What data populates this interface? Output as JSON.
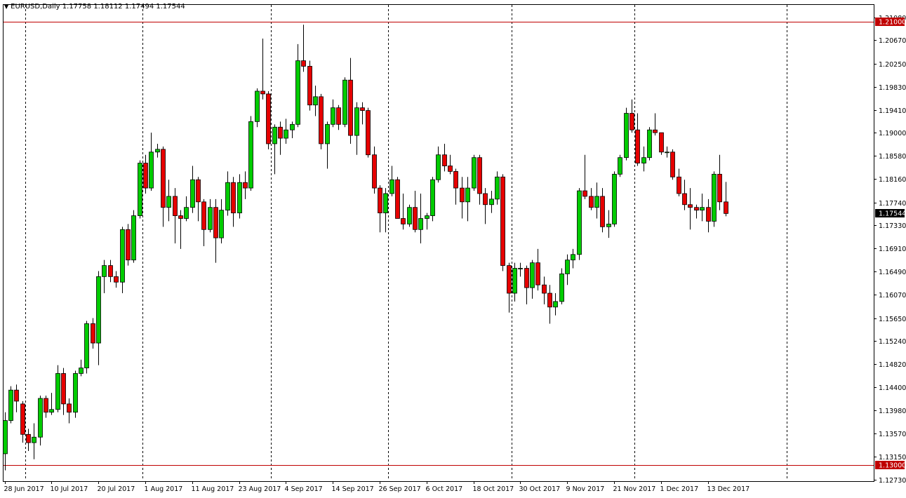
{
  "header": {
    "symbol": "EURUSD,Daily",
    "values": "1.17758 1.18112 1.17494 1.17544"
  },
  "colors": {
    "bull": "#00cc00",
    "bear": "#e60000",
    "level_line": "#c00000",
    "current_label_bg": "#000000",
    "level_label_bg": "#c00000"
  },
  "chart_data": {
    "type": "candlestick",
    "title": "EURUSD,Daily",
    "ohlc_header": [
      1.17758,
      1.18112,
      1.17494,
      1.17544
    ],
    "ylim": [
      1.1273,
      1.2135
    ],
    "y_ticks": [
      "1.21080",
      "1.20670",
      "1.20250",
      "1.19830",
      "1.19410",
      "1.19000",
      "1.18580",
      "1.18160",
      "1.17740",
      "1.17330",
      "1.16910",
      "1.16490",
      "1.16070",
      "1.15650",
      "1.15240",
      "1.14820",
      "1.14400",
      "1.13980",
      "1.13570",
      "1.13150",
      "1.12730"
    ],
    "horizontal_levels": [
      {
        "value": 1.21,
        "label": "1.21000"
      },
      {
        "value": 1.13,
        "label": "1.13000"
      }
    ],
    "current_price": {
      "value": 1.17544,
      "label": "1.17544"
    },
    "x_labels": [
      {
        "index": 0,
        "label": "28 Jun 2017"
      },
      {
        "index": 8,
        "label": "10 Jul 2017"
      },
      {
        "index": 16,
        "label": "20 Jul 2017"
      },
      {
        "index": 24,
        "label": "1 Aug 2017"
      },
      {
        "index": 32,
        "label": "11 Aug 2017"
      },
      {
        "index": 40,
        "label": "23 Aug 2017"
      },
      {
        "index": 48,
        "label": "4 Sep 2017"
      },
      {
        "index": 56,
        "label": "14 Sep 2017"
      },
      {
        "index": 64,
        "label": "26 Sep 2017"
      },
      {
        "index": 72,
        "label": "6 Oct 2017"
      },
      {
        "index": 80,
        "label": "18 Oct 2017"
      },
      {
        "index": 88,
        "label": "30 Oct 2017"
      },
      {
        "index": 96,
        "label": "9 Nov 2017"
      },
      {
        "index": 104,
        "label": "21 Nov 2017"
      },
      {
        "index": 112,
        "label": "1 Dec 2017"
      },
      {
        "index": 120,
        "label": "13 Dec 2017"
      }
    ],
    "period_separators": [
      3,
      23,
      45,
      65,
      86,
      107,
      133
    ],
    "candles": [
      [
        1.132,
        1.1395,
        1.129,
        1.138
      ],
      [
        1.138,
        1.1442,
        1.1375,
        1.1435
      ],
      [
        1.1435,
        1.1445,
        1.1395,
        1.1415
      ],
      [
        1.141,
        1.1415,
        1.134,
        1.1355
      ],
      [
        1.1355,
        1.1365,
        1.1325,
        1.134
      ],
      [
        1.134,
        1.1375,
        1.131,
        1.135
      ],
      [
        1.135,
        1.1425,
        1.1335,
        1.142
      ],
      [
        1.142,
        1.1425,
        1.1385,
        1.1395
      ],
      [
        1.1395,
        1.143,
        1.139,
        1.14
      ],
      [
        1.14,
        1.148,
        1.1395,
        1.1465
      ],
      [
        1.1465,
        1.1475,
        1.139,
        1.141
      ],
      [
        1.141,
        1.142,
        1.1375,
        1.1395
      ],
      [
        1.1395,
        1.147,
        1.1385,
        1.1465
      ],
      [
        1.1465,
        1.149,
        1.146,
        1.1475
      ],
      [
        1.1475,
        1.156,
        1.1465,
        1.1555
      ],
      [
        1.1555,
        1.1565,
        1.151,
        1.152
      ],
      [
        1.152,
        1.165,
        1.148,
        1.164
      ],
      [
        1.164,
        1.167,
        1.161,
        1.166
      ],
      [
        1.166,
        1.167,
        1.163,
        1.164
      ],
      [
        1.164,
        1.165,
        1.162,
        1.163
      ],
      [
        1.163,
        1.173,
        1.161,
        1.1725
      ],
      [
        1.1725,
        1.1735,
        1.166,
        1.167
      ],
      [
        1.167,
        1.176,
        1.1665,
        1.175
      ],
      [
        1.175,
        1.185,
        1.1745,
        1.1845
      ],
      [
        1.1845,
        1.186,
        1.179,
        1.18
      ],
      [
        1.18,
        1.19,
        1.1795,
        1.1865
      ],
      [
        1.1865,
        1.188,
        1.1855,
        1.187
      ],
      [
        1.187,
        1.1875,
        1.173,
        1.1765
      ],
      [
        1.1765,
        1.1815,
        1.174,
        1.1785
      ],
      [
        1.1785,
        1.18,
        1.17,
        1.175
      ],
      [
        1.175,
        1.176,
        1.169,
        1.1745
      ],
      [
        1.1745,
        1.1785,
        1.174,
        1.1765
      ],
      [
        1.1765,
        1.184,
        1.1755,
        1.1815
      ],
      [
        1.1815,
        1.182,
        1.174,
        1.1775
      ],
      [
        1.1775,
        1.178,
        1.1695,
        1.1725
      ],
      [
        1.1725,
        1.178,
        1.172,
        1.1765
      ],
      [
        1.1765,
        1.178,
        1.1665,
        1.171
      ],
      [
        1.171,
        1.178,
        1.17,
        1.176
      ],
      [
        1.176,
        1.183,
        1.175,
        1.181
      ],
      [
        1.181,
        1.182,
        1.173,
        1.1755
      ],
      [
        1.1755,
        1.1825,
        1.1745,
        1.181
      ],
      [
        1.181,
        1.183,
        1.178,
        1.18
      ],
      [
        1.18,
        1.193,
        1.1795,
        1.192
      ],
      [
        1.192,
        1.198,
        1.191,
        1.1975
      ],
      [
        1.1975,
        1.207,
        1.196,
        1.197
      ],
      [
        1.197,
        1.1975,
        1.187,
        1.188
      ],
      [
        1.188,
        1.1915,
        1.1825,
        1.191
      ],
      [
        1.191,
        1.192,
        1.186,
        1.189
      ],
      [
        1.189,
        1.1925,
        1.188,
        1.1905
      ],
      [
        1.1905,
        1.192,
        1.189,
        1.1915
      ],
      [
        1.1915,
        1.206,
        1.191,
        1.203
      ],
      [
        1.203,
        1.2095,
        1.201,
        1.202
      ],
      [
        1.202,
        1.203,
        1.194,
        1.195
      ],
      [
        1.195,
        1.1985,
        1.193,
        1.1965
      ],
      [
        1.1965,
        1.197,
        1.187,
        1.188
      ],
      [
        1.188,
        1.192,
        1.1835,
        1.1915
      ],
      [
        1.1915,
        1.196,
        1.191,
        1.1945
      ],
      [
        1.1945,
        1.195,
        1.1905,
        1.1915
      ],
      [
        1.1915,
        1.2,
        1.191,
        1.1995
      ],
      [
        1.1995,
        1.2035,
        1.188,
        1.1895
      ],
      [
        1.1895,
        1.1955,
        1.186,
        1.1945
      ],
      [
        1.1945,
        1.1955,
        1.1915,
        1.194
      ],
      [
        1.194,
        1.1945,
        1.1855,
        1.186
      ],
      [
        1.186,
        1.1875,
        1.179,
        1.18
      ],
      [
        1.18,
        1.1805,
        1.172,
        1.1755
      ],
      [
        1.1755,
        1.18,
        1.172,
        1.179
      ],
      [
        1.179,
        1.184,
        1.1785,
        1.1815
      ],
      [
        1.1815,
        1.182,
        1.1745,
        1.1745
      ],
      [
        1.1745,
        1.179,
        1.1725,
        1.1735
      ],
      [
        1.1735,
        1.177,
        1.173,
        1.1765
      ],
      [
        1.1765,
        1.1795,
        1.172,
        1.1725
      ],
      [
        1.1725,
        1.179,
        1.17,
        1.1745
      ],
      [
        1.1745,
        1.1755,
        1.1725,
        1.175
      ],
      [
        1.175,
        1.182,
        1.174,
        1.1815
      ],
      [
        1.1815,
        1.1875,
        1.181,
        1.186
      ],
      [
        1.186,
        1.188,
        1.183,
        1.184
      ],
      [
        1.184,
        1.186,
        1.1825,
        1.183
      ],
      [
        1.183,
        1.1835,
        1.177,
        1.18
      ],
      [
        1.18,
        1.182,
        1.1745,
        1.1775
      ],
      [
        1.1775,
        1.182,
        1.174,
        1.18
      ],
      [
        1.18,
        1.186,
        1.1795,
        1.1855
      ],
      [
        1.1855,
        1.186,
        1.177,
        1.179
      ],
      [
        1.179,
        1.18,
        1.1735,
        1.177
      ],
      [
        1.177,
        1.1795,
        1.1755,
        1.178
      ],
      [
        1.178,
        1.183,
        1.177,
        1.182
      ],
      [
        1.182,
        1.1825,
        1.165,
        1.166
      ],
      [
        1.166,
        1.1665,
        1.1575,
        1.161
      ],
      [
        1.161,
        1.1665,
        1.1595,
        1.1655
      ],
      [
        1.1655,
        1.1665,
        1.164,
        1.1655
      ],
      [
        1.1655,
        1.166,
        1.159,
        1.162
      ],
      [
        1.162,
        1.167,
        1.16,
        1.1665
      ],
      [
        1.1665,
        1.169,
        1.1615,
        1.1625
      ],
      [
        1.1625,
        1.164,
        1.159,
        1.161
      ],
      [
        1.161,
        1.1625,
        1.1555,
        1.1585
      ],
      [
        1.1585,
        1.161,
        1.157,
        1.1595
      ],
      [
        1.1595,
        1.1655,
        1.159,
        1.1645
      ],
      [
        1.1645,
        1.168,
        1.1625,
        1.167
      ],
      [
        1.167,
        1.169,
        1.1655,
        1.168
      ],
      [
        1.168,
        1.18,
        1.167,
        1.1795
      ],
      [
        1.1795,
        1.186,
        1.178,
        1.1785
      ],
      [
        1.1785,
        1.18,
        1.176,
        1.1765
      ],
      [
        1.1765,
        1.181,
        1.1745,
        1.1785
      ],
      [
        1.1785,
        1.18,
        1.172,
        1.173
      ],
      [
        1.173,
        1.176,
        1.171,
        1.1735
      ],
      [
        1.1735,
        1.183,
        1.173,
        1.1825
      ],
      [
        1.1825,
        1.186,
        1.182,
        1.1855
      ],
      [
        1.1855,
        1.1945,
        1.185,
        1.1935
      ],
      [
        1.1935,
        1.196,
        1.19,
        1.1905
      ],
      [
        1.1905,
        1.1935,
        1.184,
        1.1845
      ],
      [
        1.1845,
        1.1875,
        1.183,
        1.1855
      ],
      [
        1.1855,
        1.191,
        1.185,
        1.1905
      ],
      [
        1.1905,
        1.1935,
        1.1895,
        1.19
      ],
      [
        1.19,
        1.188,
        1.186,
        1.1865
      ],
      [
        1.1865,
        1.1875,
        1.1855,
        1.1865
      ],
      [
        1.1865,
        1.187,
        1.1815,
        1.182
      ],
      [
        1.182,
        1.1835,
        1.1785,
        1.179
      ],
      [
        1.179,
        1.1815,
        1.176,
        1.177
      ],
      [
        1.177,
        1.18,
        1.1725,
        1.1765
      ],
      [
        1.1765,
        1.177,
        1.1745,
        1.176
      ],
      [
        1.176,
        1.179,
        1.174,
        1.1765
      ],
      [
        1.1765,
        1.178,
        1.172,
        1.174
      ],
      [
        1.174,
        1.183,
        1.173,
        1.1825
      ],
      [
        1.1825,
        1.186,
        1.176,
        1.1775
      ],
      [
        1.1775,
        1.1811,
        1.1749,
        1.1754
      ]
    ]
  }
}
